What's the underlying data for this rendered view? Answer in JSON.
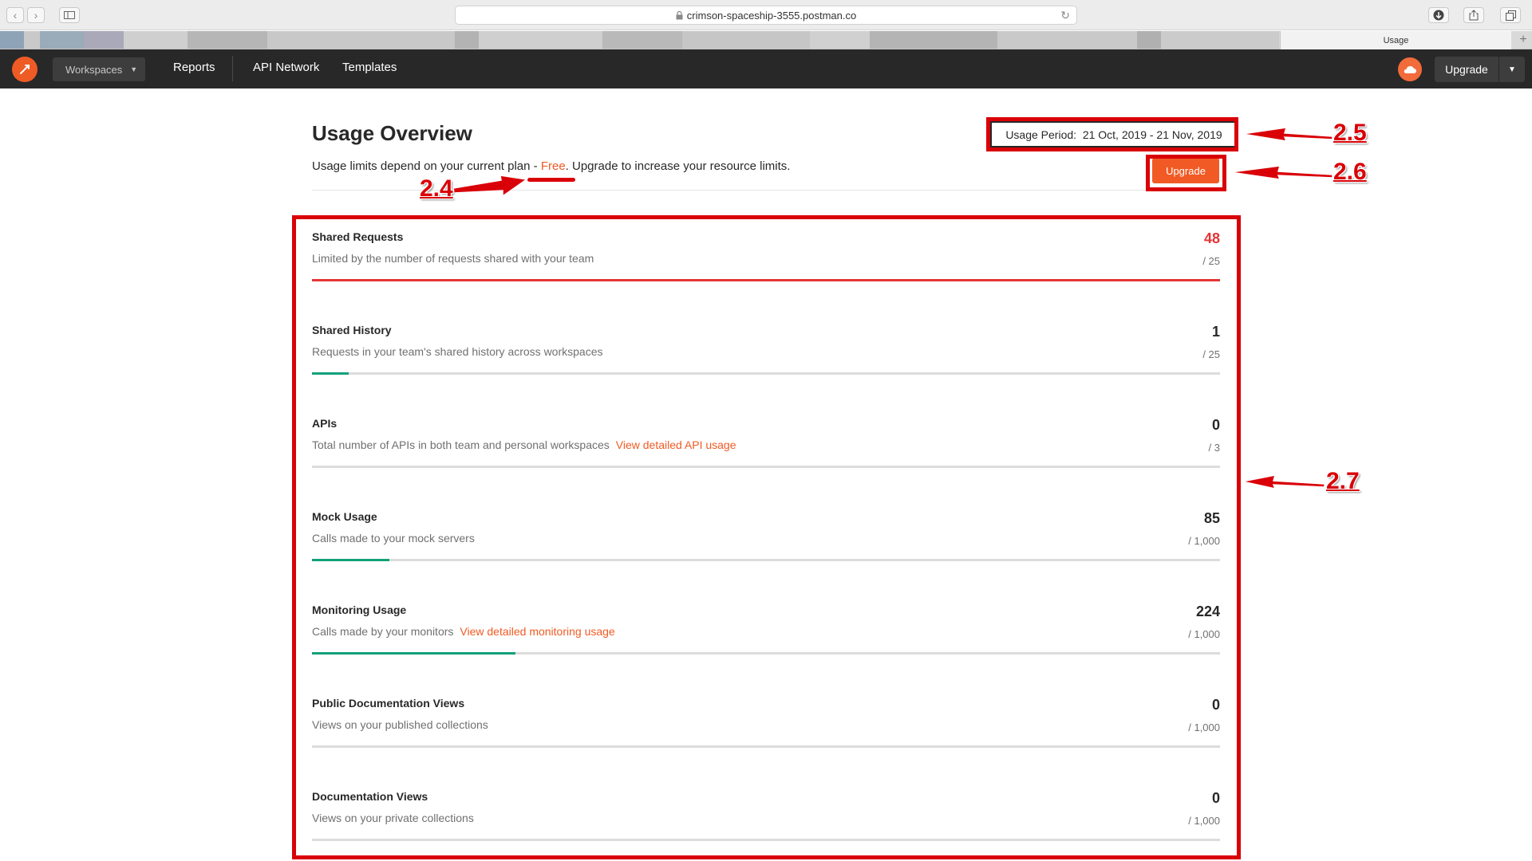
{
  "browser": {
    "url": "crimson-spaceship-3555.postman.co",
    "active_tab": "Usage",
    "new_tab": "+"
  },
  "header": {
    "workspaces_label": "Workspaces",
    "nav": [
      "Reports",
      "API Network",
      "Templates"
    ],
    "upgrade_label": "Upgrade"
  },
  "overview": {
    "title": "Usage Overview",
    "subtitle_before": "Usage limits depend on your current plan - ",
    "plan": "Free",
    "subtitle_after": ". Upgrade to increase your resource limits.",
    "period_label": "Usage Period:",
    "period_value": "21 Oct, 2019 - 21 Nov, 2019",
    "upgrade_label": "Upgrade"
  },
  "metrics": [
    {
      "title": "Shared Requests",
      "description": "Limited by the number of requests shared with your team",
      "link": "",
      "used": "48",
      "limit": "/ 25",
      "fraction": 1.0,
      "over": true
    },
    {
      "title": "Shared History",
      "description": "Requests in your team's shared history across workspaces",
      "link": "",
      "used": "1",
      "limit": "/ 25",
      "fraction": 0.04,
      "over": false
    },
    {
      "title": "APIs",
      "description": "Total number of APIs in both team and personal workspaces",
      "link": "View detailed API usage",
      "used": "0",
      "limit": "/ 3",
      "fraction": 0,
      "over": false
    },
    {
      "title": "Mock Usage",
      "description": "Calls made to your mock servers",
      "link": "",
      "used": "85",
      "limit": "/ 1,000",
      "fraction": 0.085,
      "over": false
    },
    {
      "title": "Monitoring Usage",
      "description": "Calls made by your monitors",
      "link": "View detailed monitoring usage",
      "used": "224",
      "limit": "/ 1,000",
      "fraction": 0.224,
      "over": false
    },
    {
      "title": "Public Documentation Views",
      "description": "Views on your published collections",
      "link": "",
      "used": "0",
      "limit": "/ 1,000",
      "fraction": 0,
      "over": false
    },
    {
      "title": "Documentation Views",
      "description": "Views on your private collections",
      "link": "",
      "used": "0",
      "limit": "/ 1,000",
      "fraction": 0,
      "over": false
    }
  ],
  "annotations": {
    "labels": [
      "2.4",
      "2.5",
      "2.6",
      "2.7"
    ],
    "color": "#d90007"
  },
  "colors": {
    "accent": "#f15a24",
    "over_limit": "#e53535",
    "progress": "#12a07a",
    "appbar": "#282828"
  }
}
